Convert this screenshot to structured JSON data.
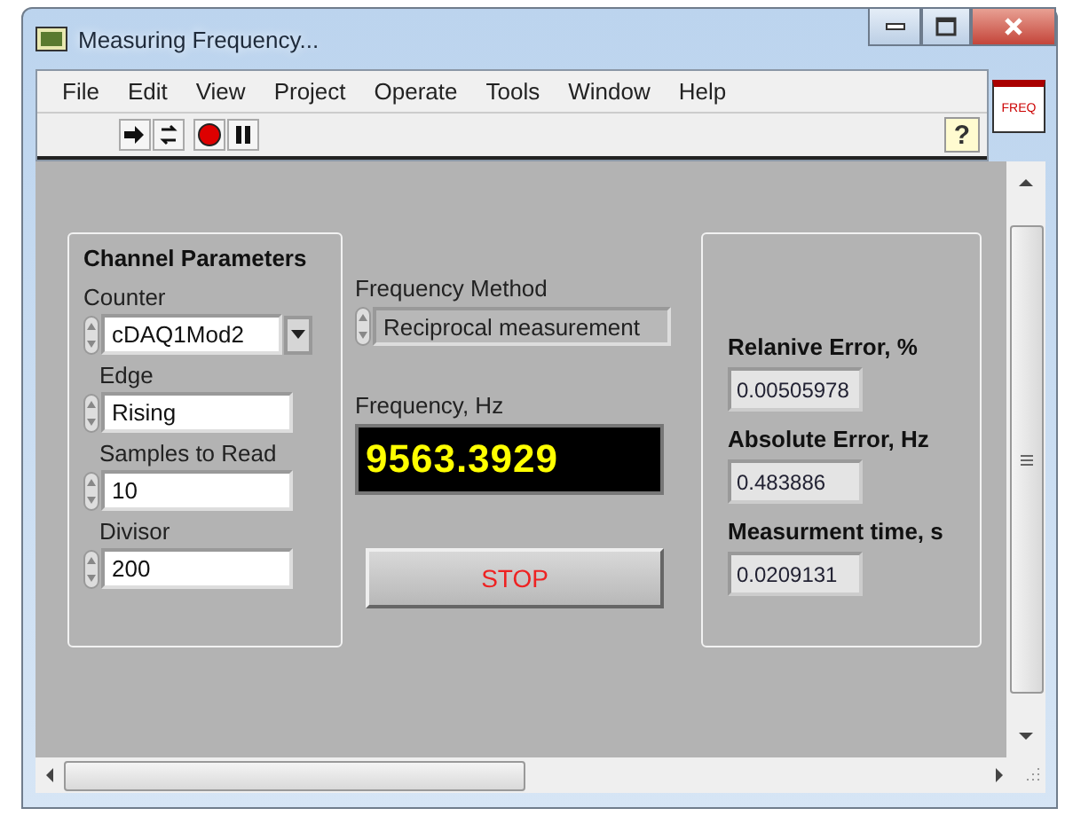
{
  "window": {
    "title": "Measuring Frequency..."
  },
  "menu": [
    "File",
    "Edit",
    "View",
    "Project",
    "Operate",
    "Tools",
    "Window",
    "Help"
  ],
  "toolbar": {
    "help": "?"
  },
  "vi_icon": {
    "label": "FREQ"
  },
  "channel_parameters": {
    "title": "Channel Parameters",
    "controls": [
      {
        "label": "Counter",
        "value": "cDAQ1Mod2",
        "kind": "dropdown"
      },
      {
        "label": "Edge",
        "value": "Rising",
        "kind": "ring"
      },
      {
        "label": "Samples to Read",
        "value": "10",
        "kind": "numeric"
      },
      {
        "label": "Divisor",
        "value": "200",
        "kind": "numeric"
      }
    ]
  },
  "frequency_method": {
    "label": "Frequency Method",
    "value": "Reciprocal measurement"
  },
  "frequency": {
    "label": "Frequency, Hz",
    "value": "9563.3929"
  },
  "stop_button": {
    "label": "STOP"
  },
  "results": [
    {
      "label": "Relanive Error, %",
      "value": "0.00505978"
    },
    {
      "label": "Absolute Error, Hz",
      "value": "0.483886"
    },
    {
      "label": "Measurment time, s",
      "value": "0.0209131"
    }
  ]
}
